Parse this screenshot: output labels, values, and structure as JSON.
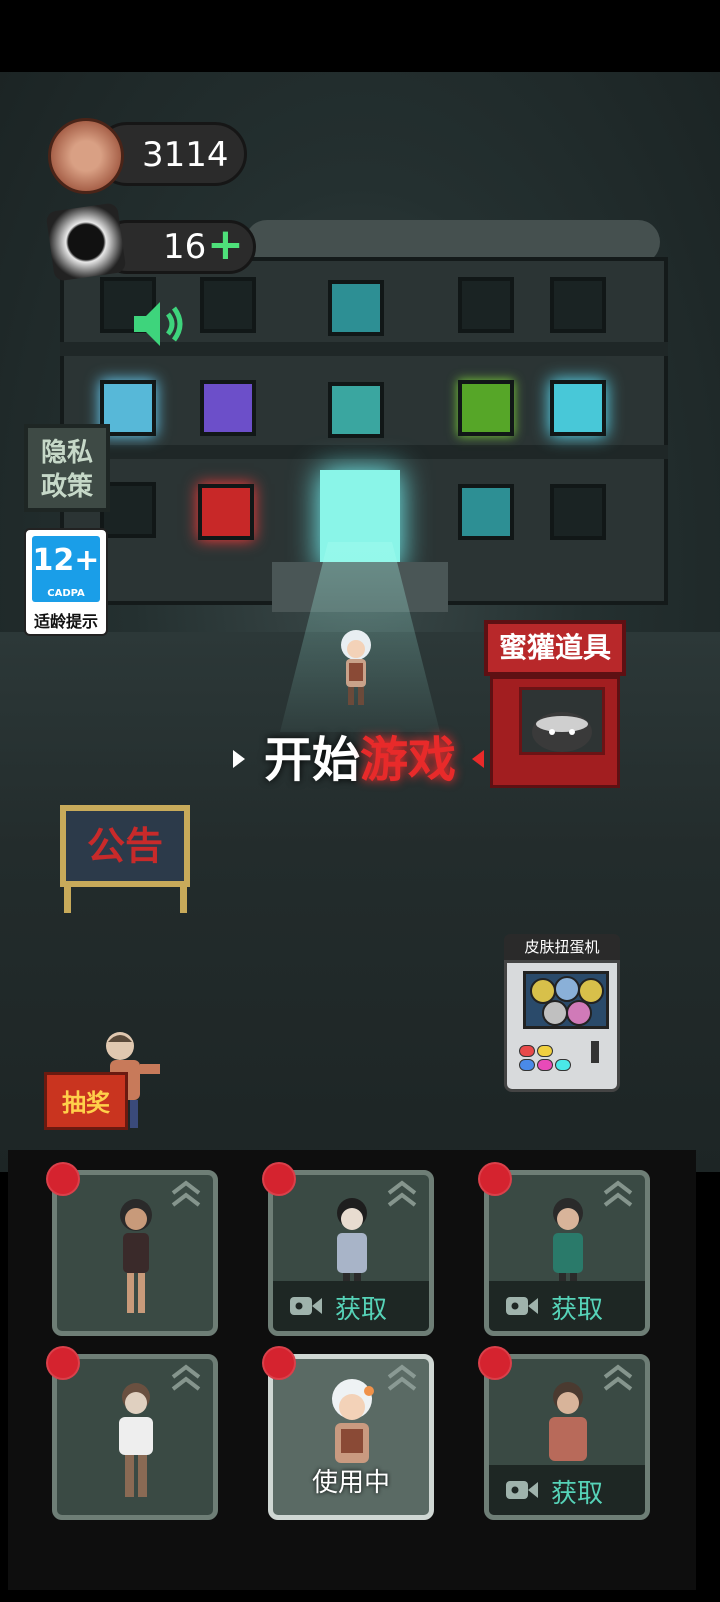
{
  "hud": {
    "coins": "3114",
    "puzzle_pieces": "16",
    "plus_symbol": "+",
    "coin_icon": "zombie-coin-icon",
    "sound_icon": "speaker-icon"
  },
  "side": {
    "privacy_label_line1": "隐私",
    "privacy_label_line2": "政策",
    "age_rating": "12+",
    "age_org": "CADPA",
    "age_hint": "适龄提示"
  },
  "world": {
    "shop_label": "蜜獾道具",
    "start_part1": "开始",
    "start_part2": "游戏",
    "notice_label": "公告",
    "gacha_label": "皮肤扭蛋机",
    "lottery_label": "抽奖"
  },
  "skins": [
    {
      "state": "owned",
      "label": ""
    },
    {
      "state": "locked",
      "label": "获取"
    },
    {
      "state": "locked",
      "label": "获取"
    },
    {
      "state": "owned",
      "label": ""
    },
    {
      "state": "in_use",
      "label": "使用中"
    },
    {
      "state": "locked",
      "label": "获取"
    }
  ],
  "colors": {
    "accent_red": "#e82a2a",
    "get_text": "#56d3b8",
    "badge_red": "#d5232f",
    "plus_green": "#4ee07a"
  }
}
